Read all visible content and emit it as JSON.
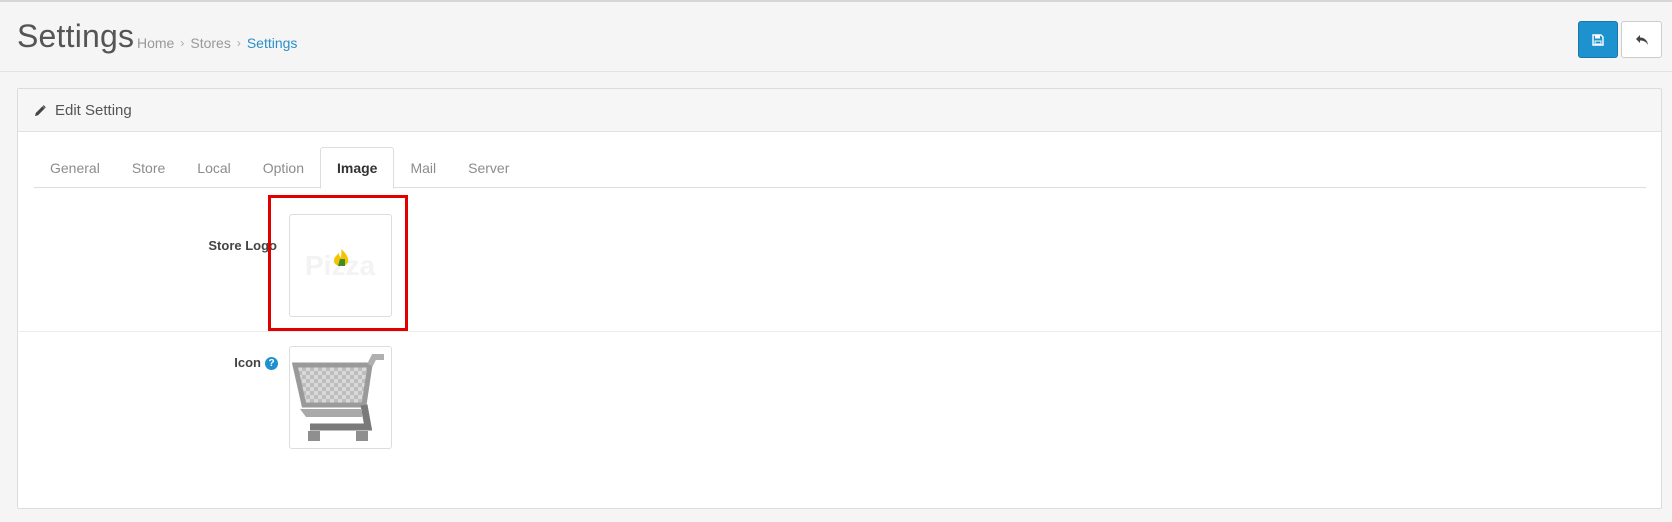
{
  "header": {
    "title": "Settings",
    "breadcrumb": [
      "Home",
      "Stores",
      "Settings"
    ],
    "save_icon": "floppy-disk-icon",
    "back_icon": "reply-arrow-icon"
  },
  "panel": {
    "title": "Edit Setting",
    "title_icon": "pencil-icon"
  },
  "tabs": [
    {
      "label": "General"
    },
    {
      "label": "Store"
    },
    {
      "label": "Local"
    },
    {
      "label": "Option"
    },
    {
      "label": "Image",
      "active": true
    },
    {
      "label": "Mail"
    },
    {
      "label": "Server"
    }
  ],
  "fields": {
    "store_logo": {
      "label": "Store Logo"
    },
    "icon": {
      "label": "Icon",
      "help": "?"
    }
  },
  "colors": {
    "primary": "#1e91cf",
    "active_link": "#2a8fc8",
    "highlight": "#e00000"
  }
}
